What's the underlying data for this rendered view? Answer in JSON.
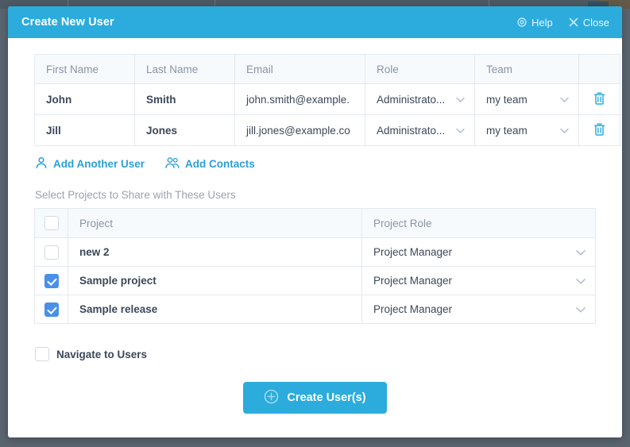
{
  "modal": {
    "title": "Create New User",
    "help_label": "Help",
    "close_label": "Close",
    "header_color": "#2BACDC"
  },
  "users_table": {
    "columns": [
      "First Name",
      "Last Name",
      "Email",
      "Role",
      "Team",
      ""
    ],
    "rows": [
      {
        "first_name": "John",
        "last_name": "Smith",
        "email": "john.smith@example.",
        "role": "Administrato...",
        "team": "my team",
        "delete_icon": "trash-icon"
      },
      {
        "first_name": "Jill",
        "last_name": "Jones",
        "email": "jill.jones@example.co",
        "role": "Administrato...",
        "team": "my team",
        "delete_icon": "trash-icon"
      }
    ]
  },
  "links": {
    "add_user": "Add Another User",
    "add_user_icon": "user-icon",
    "add_contacts": "Add Contacts",
    "add_contacts_icon": "users-icon",
    "color": "#2e9fd4"
  },
  "projects_section": {
    "label": "Select Projects to Share with These Users",
    "columns": [
      "",
      "Project",
      "Project Role"
    ],
    "header_checked": false,
    "rows": [
      {
        "checked": false,
        "project": "new 2",
        "role": "Project Manager"
      },
      {
        "checked": true,
        "project": "Sample project",
        "role": "Project Manager"
      },
      {
        "checked": true,
        "project": "Sample release",
        "role": "Project Manager"
      }
    ],
    "checkbox_color": "#4A90E8"
  },
  "navigate": {
    "label": "Navigate to Users",
    "checked": false
  },
  "submit": {
    "label": "Create User(s)",
    "icon": "plus-circle-icon",
    "color": "#2BACDC"
  }
}
